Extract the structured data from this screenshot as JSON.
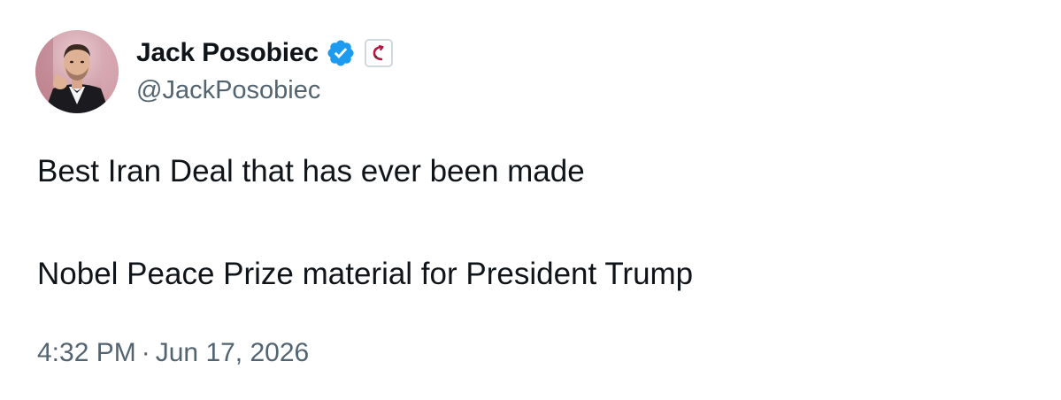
{
  "author": {
    "display_name": "Jack Posobiec",
    "handle": "@JackPosobiec",
    "verified": true,
    "verified_color": "#1d9bf0",
    "affiliate_icon": "affiliate-badge-icon"
  },
  "tweet": {
    "lines": [
      "Best Iran Deal that has ever been made",
      "Nobel Peace Prize material for President Trump"
    ],
    "time": "4:32 PM",
    "separator": "·",
    "date": "Jun 17, 2026"
  },
  "colors": {
    "text_primary": "#0f1419",
    "text_secondary": "#536471",
    "background": "#ffffff"
  }
}
